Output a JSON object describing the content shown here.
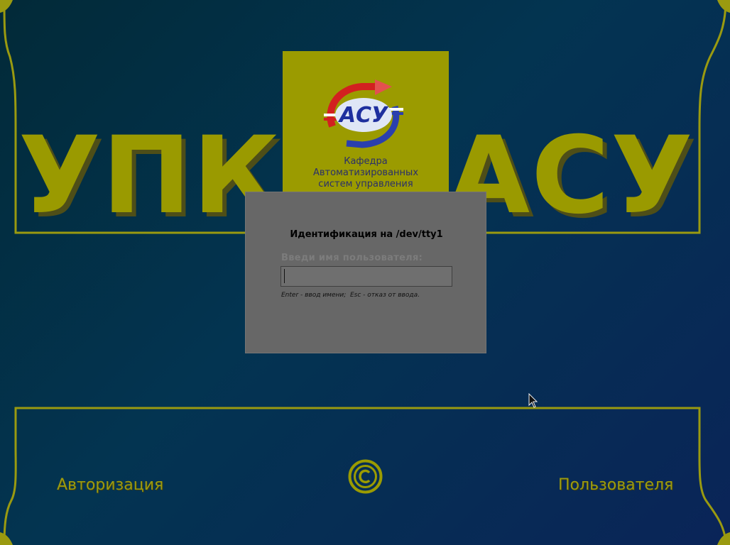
{
  "title": {
    "left": "УПК",
    "right": "АСУ"
  },
  "logo": {
    "mark_text": "АСУ",
    "caption": [
      "Кафедра",
      "Автоматизированных",
      "систем управления"
    ]
  },
  "dialog": {
    "title": "Идентификация на /dev/tty1",
    "field_label": "Введи имя пользователя:",
    "input_value": "",
    "hint": "Enter - ввод имени;  Esc - отказ от ввода."
  },
  "footer": {
    "left_link": "Авторизация",
    "right_link": "Пользователя",
    "copyright_icon": "copyright-icon"
  },
  "colors": {
    "background": "#033451",
    "accent": "#9b9b00",
    "dialog_bg": "#676767"
  }
}
